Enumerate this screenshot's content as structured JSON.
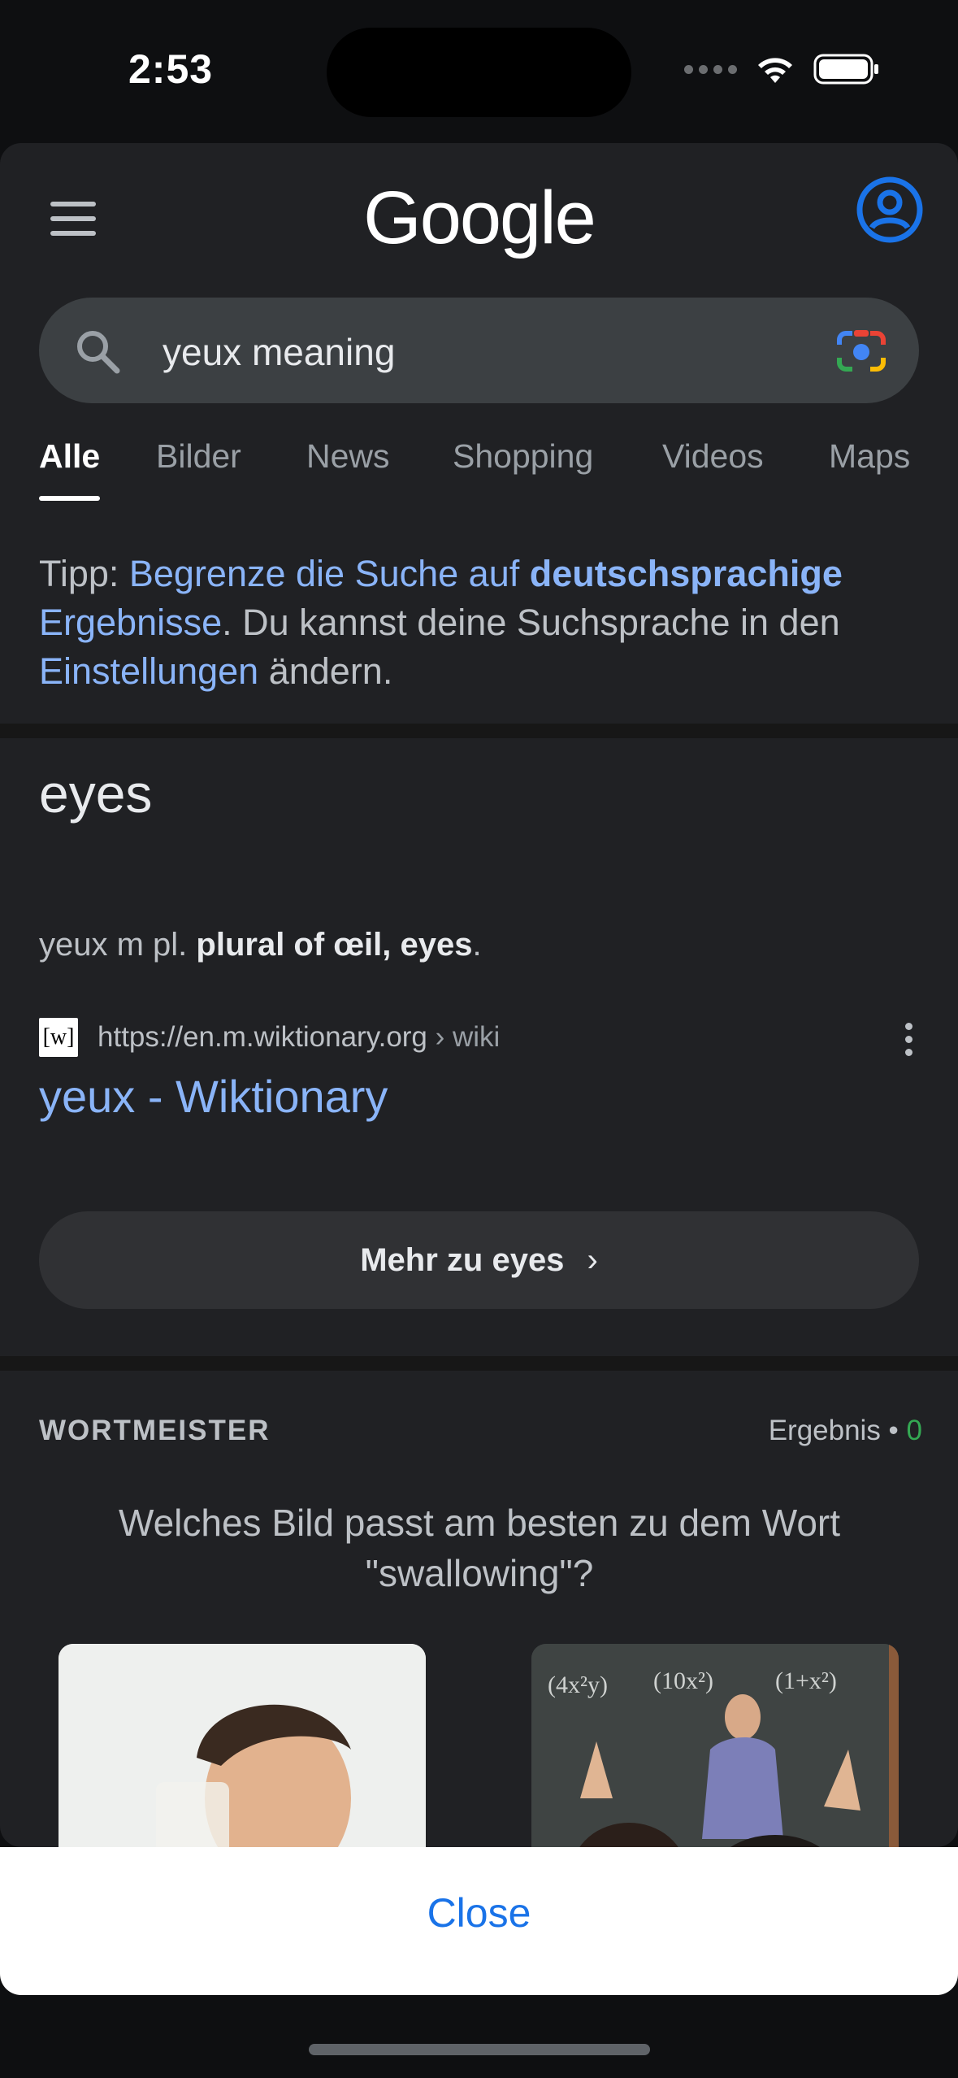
{
  "status_bar": {
    "time": "2:53"
  },
  "header": {
    "logo": "Google"
  },
  "search": {
    "query": "yeux meaning"
  },
  "tabs": [
    {
      "label": "Alle"
    },
    {
      "label": "Bilder"
    },
    {
      "label": "News"
    },
    {
      "label": "Shopping"
    },
    {
      "label": "Videos"
    },
    {
      "label": "Maps"
    }
  ],
  "tip": {
    "prefix": "Tipp: ",
    "link1": "Begrenze die Suche auf ",
    "link_bold": "deutschsprachige",
    "link2": "Ergebnisse",
    "middle": ". Du kannst deine Suchsprache in den ",
    "link3": "Einstellungen",
    "suffix": " ändern."
  },
  "answer": {
    "title": "eyes",
    "snippet_plain": "yeux m pl. ",
    "snippet_bold": "plural of œil, eyes",
    "snippet_end": ".",
    "favicon_text": "[w]",
    "url": "https://en.m.wiktionary.org",
    "crumb": " › wiki",
    "result_title": "yeux - Wiktionary",
    "more_button": "Mehr zu eyes"
  },
  "wortmeister": {
    "label": "WORTMEISTER",
    "score_label": "Ergebnis • ",
    "score_value": "0",
    "question": "Welches Bild passt am besten zu dem Wort \"swallowing\"?"
  },
  "close_sheet": {
    "close_label": "Close"
  },
  "colors": {
    "background": "#202124",
    "link": "#8ab4f8",
    "accent_blue": "#1a73e8",
    "score_green": "#34a853"
  }
}
